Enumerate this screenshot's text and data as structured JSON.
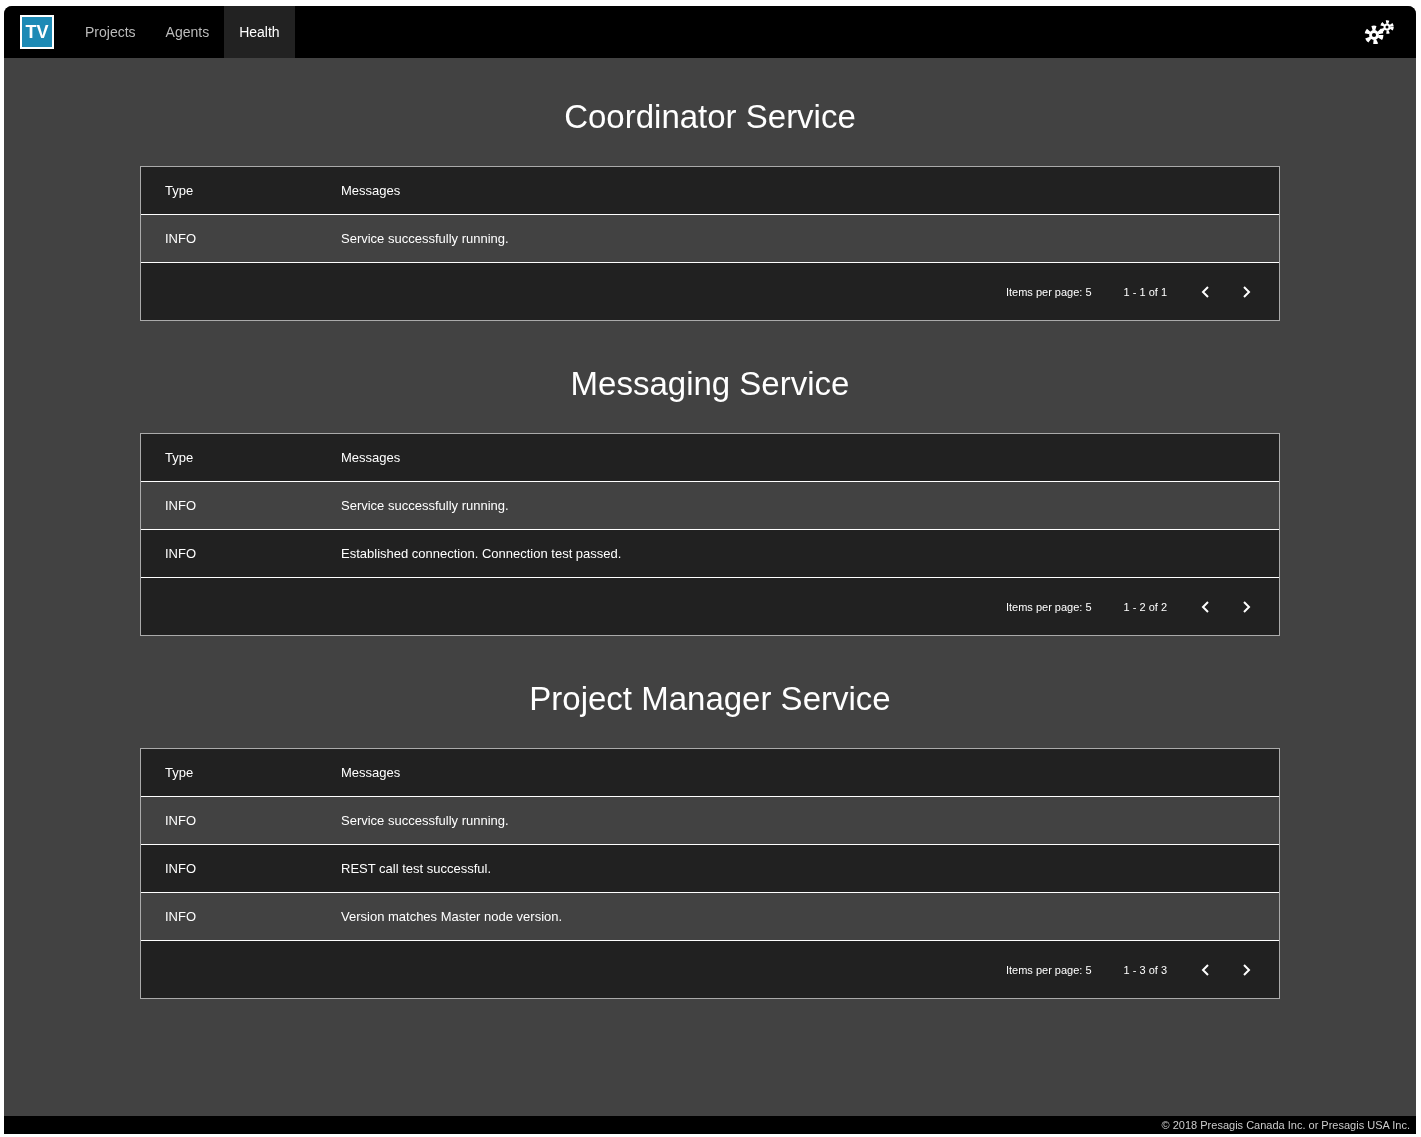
{
  "navbar": {
    "logo": "TV",
    "tabs": [
      {
        "label": "Projects",
        "selected": false
      },
      {
        "label": "Agents",
        "selected": false
      },
      {
        "label": "Health",
        "selected": true
      }
    ]
  },
  "services": [
    {
      "title": "Coordinator Service",
      "columns": [
        "Type",
        "Messages"
      ],
      "rows": [
        {
          "type": "INFO",
          "message": "Service successfully running."
        }
      ],
      "paginator": {
        "items_per_page": "Items per page: 5",
        "range": "1 - 1 of 1"
      }
    },
    {
      "title": "Messaging Service",
      "columns": [
        "Type",
        "Messages"
      ],
      "rows": [
        {
          "type": "INFO",
          "message": "Service successfully running."
        },
        {
          "type": "INFO",
          "message": "Established connection. Connection test passed."
        }
      ],
      "paginator": {
        "items_per_page": "Items per page: 5",
        "range": "1 - 2 of 2"
      }
    },
    {
      "title": "Project Manager Service",
      "columns": [
        "Type",
        "Messages"
      ],
      "rows": [
        {
          "type": "INFO",
          "message": "Service successfully running."
        },
        {
          "type": "INFO",
          "message": "REST call test successful."
        },
        {
          "type": "INFO",
          "message": "Version matches Master node version."
        }
      ],
      "paginator": {
        "items_per_page": "Items per page: 5",
        "range": "1 - 3 of 3"
      }
    }
  ],
  "footer": "© 2018 Presagis Canada Inc. or Presagis USA Inc."
}
